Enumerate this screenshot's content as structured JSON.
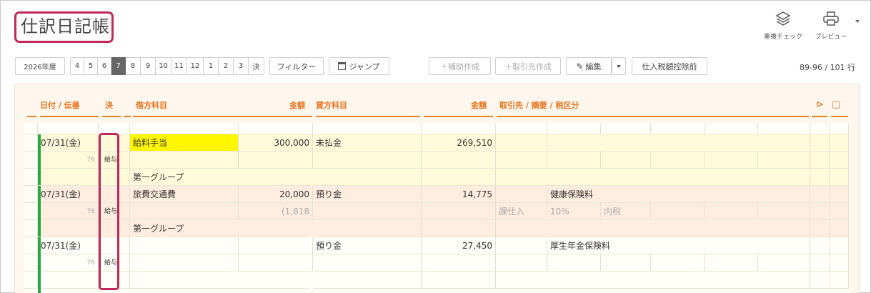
{
  "title": "仕訳日記帳",
  "top_tools": [
    {
      "label": "重複チェック",
      "icon": "layers-icon"
    },
    {
      "label": "プレビュー",
      "icon": "printer-icon"
    }
  ],
  "toolbar": {
    "year": "2026年度",
    "months": [
      "4",
      "5",
      "6",
      "7",
      "8",
      "9",
      "10",
      "11",
      "12",
      "1",
      "2",
      "3",
      "決"
    ],
    "active_month": "7",
    "filter": "フィルター",
    "jump": "ジャンプ",
    "add_sub": "＋補助作成",
    "add_partner": "＋取引先作成",
    "edit": "編集",
    "tax_button": "仕入税額控除前",
    "range": "89-96 / 101 行"
  },
  "headers": {
    "date": "日付 / 伝番",
    "kessai": "決",
    "debit_account": "借方科目",
    "debit_amount": "金額",
    "credit_account": "貸方科目",
    "credit_amount": "金額",
    "memo": "取引先 / 摘要 / 税区分"
  },
  "entries": [
    {
      "date": "07/31(金)",
      "no": "76",
      "type": "給与",
      "debit_account": "給料手当",
      "debit_amount": "300,000",
      "credit_account": "未払金",
      "credit_amount": "269,510",
      "memo": "",
      "debit_tax": "",
      "tax_cat": "",
      "tax_rate": "",
      "tax_type": "",
      "group": "第一グループ"
    },
    {
      "date": "07/31(金)",
      "no": "76",
      "type": "給与",
      "debit_account": "旅費交通費",
      "debit_amount": "20,000",
      "credit_account": "預り金",
      "credit_amount": "14,775",
      "memo": "健康保険料",
      "debit_tax": "(1,818",
      "tax_cat": "課仕入",
      "tax_rate": "10%",
      "tax_type": "内税",
      "group": "第一グループ"
    },
    {
      "date": "07/31(金)",
      "no": "76",
      "type": "給与",
      "debit_account": "",
      "debit_amount": "",
      "credit_account": "預り金",
      "credit_amount": "27,450",
      "memo": "厚生年金保険料",
      "debit_tax": "",
      "tax_cat": "",
      "tax_rate": "",
      "tax_type": "",
      "group": ""
    }
  ],
  "colors": {
    "accent": "#e8701a",
    "highlight": "#c0275a",
    "green_bar": "#28a745",
    "yellow_highlight": "#fff600"
  }
}
